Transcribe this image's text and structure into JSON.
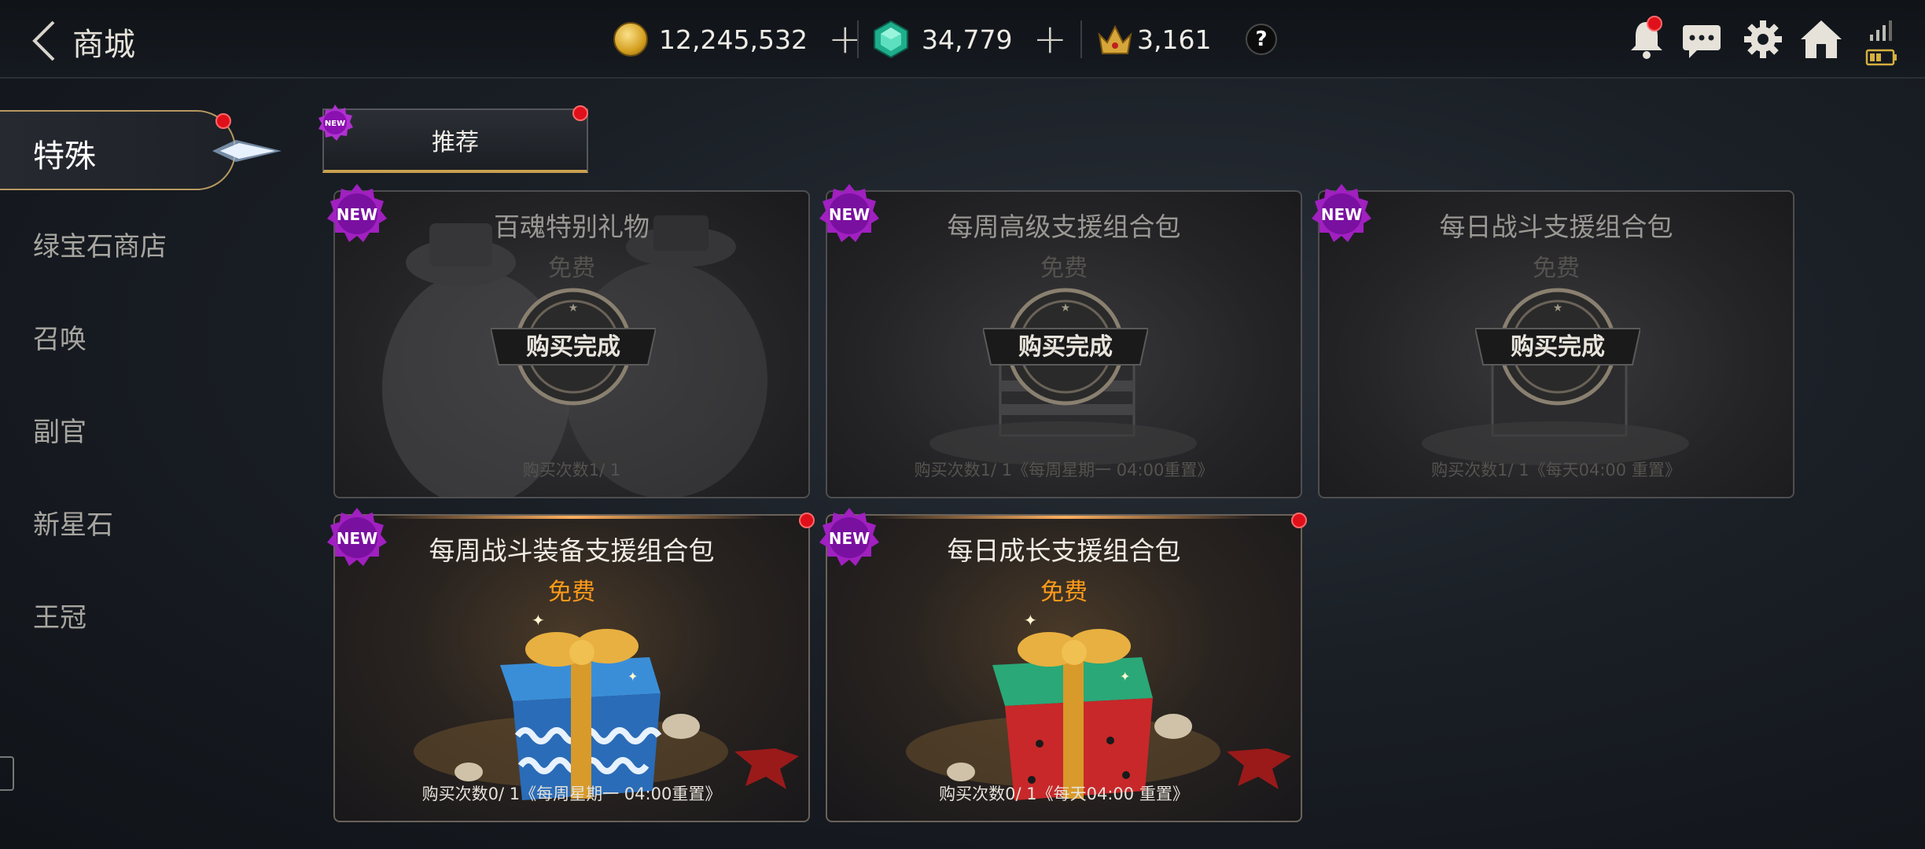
{
  "header": {
    "title": "商城",
    "currencies": [
      {
        "name": "gold-coin",
        "value": "12,245,532"
      },
      {
        "name": "emerald",
        "value": "34,779"
      },
      {
        "name": "crown",
        "value": "3,161"
      }
    ],
    "help_label": "?"
  },
  "sidebar": {
    "items": [
      {
        "label": "特殊",
        "active": true
      },
      {
        "label": "绿宝石商店"
      },
      {
        "label": "召唤"
      },
      {
        "label": "副官"
      },
      {
        "label": "新星石"
      },
      {
        "label": "王冠"
      }
    ]
  },
  "subtabs": [
    {
      "label": "推荐",
      "badge": "NEW"
    }
  ],
  "cards": [
    {
      "title": "百魂特别礼物",
      "price": "免费",
      "seal": "购买完成",
      "limit": "购买次数1/ 1",
      "badge": "NEW",
      "state": "purchased"
    },
    {
      "title": "每周高级支援组合包",
      "price": "免费",
      "seal": "购买完成",
      "limit": "购买次数1/ 1《每周星期一 04:00重置》",
      "badge": "NEW",
      "state": "purchased"
    },
    {
      "title": "每日战斗支援组合包",
      "price": "免费",
      "seal": "购买完成",
      "limit": "购买次数1/ 1《每天04:00 重置》",
      "badge": "NEW",
      "state": "purchased"
    },
    {
      "title": "每周战斗装备支援组合包",
      "price": "免费",
      "limit": "购买次数0/ 1《每周星期一 04:00重置》",
      "badge": "NEW",
      "state": "available"
    },
    {
      "title": "每日成长支援组合包",
      "price": "免费",
      "limit": "购买次数0/ 1《每天04:00 重置》",
      "badge": "NEW",
      "state": "available"
    }
  ],
  "colors": {
    "accent_gold": "#c9a050",
    "price_free": "#ff9a1a",
    "notify_red": "#e0101a",
    "new_badge": "#a020c0"
  }
}
